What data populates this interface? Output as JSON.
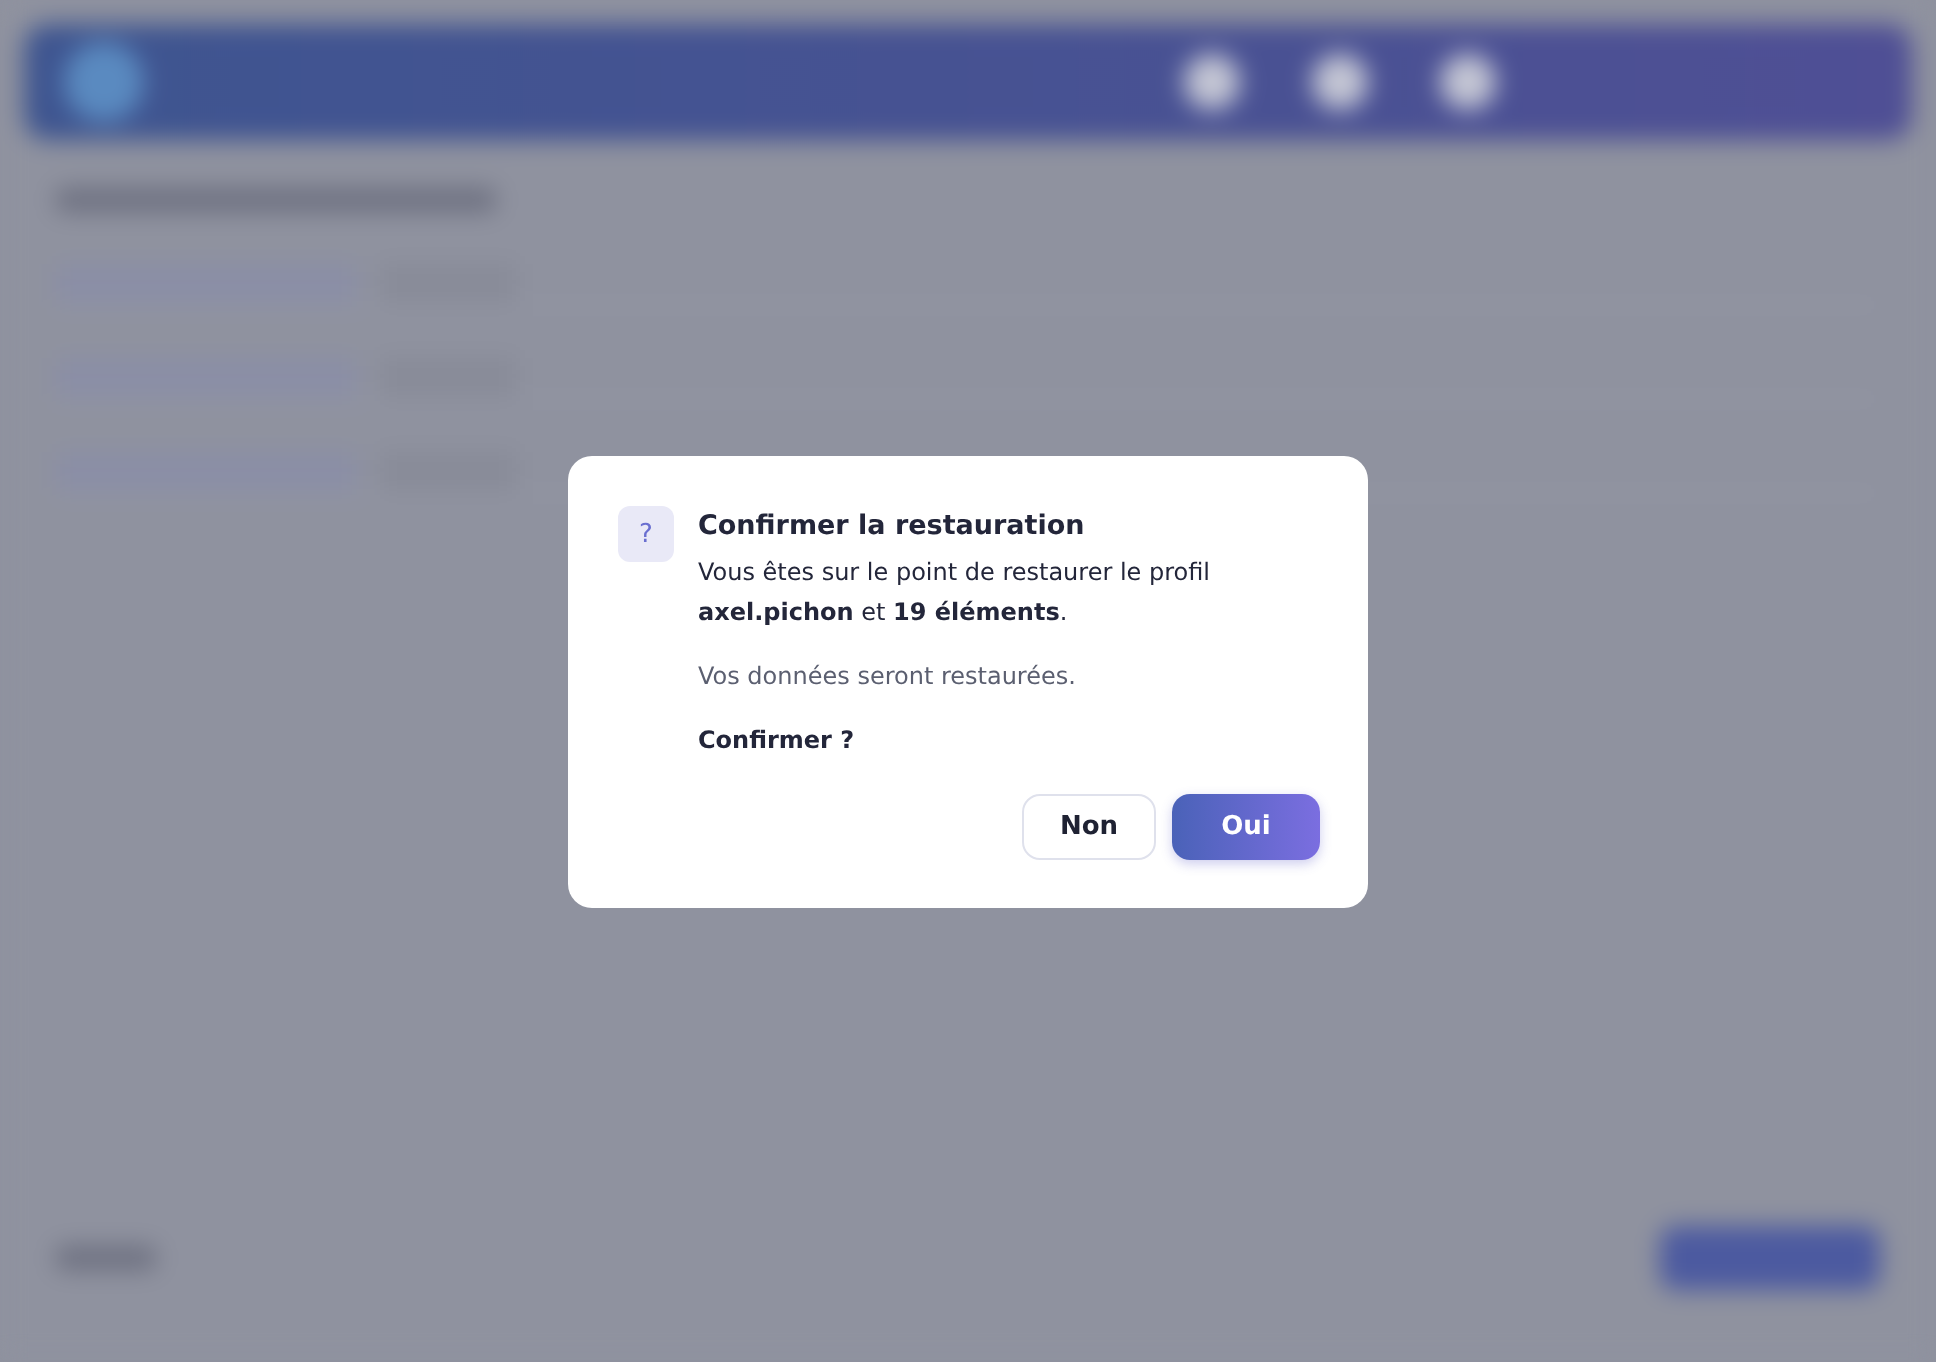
{
  "dialog": {
    "icon": "?",
    "title": "Confirmer la restauration",
    "message": "Vous êtes sur le point de restaurer le profil **axel.pichon** et **19 éléments**.",
    "note": "Vos données seront restaurées.",
    "question": "Confirmer ?",
    "buttons": [
      {
        "label": "Non",
        "kind": "secondary"
      },
      {
        "label": "Oui",
        "kind": "primary"
      }
    ]
  }
}
